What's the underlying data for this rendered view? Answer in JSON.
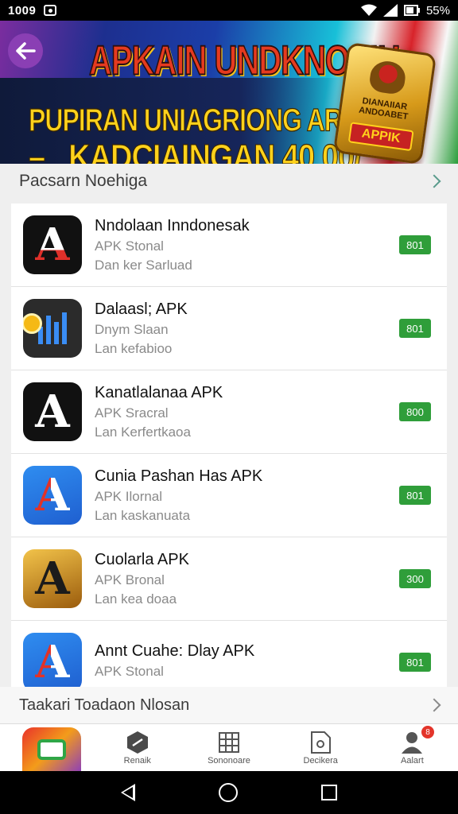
{
  "status_bar": {
    "time": "1009",
    "battery": "55%"
  },
  "banner": {
    "title": "APKAIN UNDKNOSIH",
    "line2": "PUPIRAN UNIAGRIONG AR",
    "line3_left": "–",
    "line3_right": "KADCIAINGAN 40 00/",
    "badge_text": "DIANAIIAR ANDOABET",
    "badge_sub": "APPIK"
  },
  "section": {
    "title": "Pacsarn Noehiga"
  },
  "apps": [
    {
      "name": "Nndolaan Inndonesak",
      "sub": "APK Stonal",
      "desc": "Dan ker Sarluad",
      "button": "801",
      "icon": "letter-a-icon"
    },
    {
      "name": "Dalaasl; APK",
      "sub": "Dnym Slaan",
      "desc": "Lan kefabioo",
      "button": "801",
      "icon": "chart-coin-icon"
    },
    {
      "name": "Kanatlalanaa APK",
      "sub": "APK Sracral",
      "desc": "Lan Kerfertkaoa",
      "button": "800",
      "icon": "letter-a-icon"
    },
    {
      "name": "Cunia Pashan Has APK",
      "sub": "APK Ilornal",
      "desc": "Lan kaskanuata",
      "button": "801",
      "icon": "letter-a-icon"
    },
    {
      "name": "Cuolarla APK",
      "sub": "APK Bronal",
      "desc": "Lan kea doaa",
      "button": "300",
      "icon": "letter-a-icon"
    },
    {
      "name": "Annt Cuahe: Dlay APK",
      "sub": "APK Stonal",
      "desc": "",
      "button": "801",
      "icon": "letter-a-icon"
    }
  ],
  "icon_glyph": "A",
  "bottom_link": {
    "label": "Taakari Toadaon Nlosan"
  },
  "nav": {
    "items": [
      {
        "label": "",
        "icon": "home-app-icon"
      },
      {
        "label": "Renaik",
        "icon": "hexagon-icon"
      },
      {
        "label": "Sononoare",
        "icon": "grid-icon"
      },
      {
        "label": "Decikera",
        "icon": "document-icon"
      },
      {
        "label": "Aalart",
        "icon": "user-icon",
        "badge": "8"
      }
    ]
  },
  "colors": {
    "accent_green": "#2f9e3a",
    "chevron_teal": "#5a9b8c",
    "banner_purple": "#8a3fb4"
  }
}
